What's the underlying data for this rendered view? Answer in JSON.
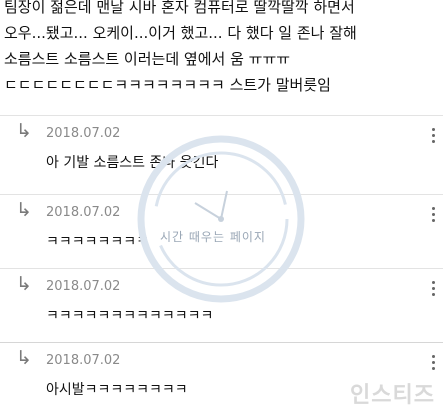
{
  "post": {
    "lines": [
      "팀장이 젊은데 맨날 시바 혼자 컴퓨터로 딸깍딸깍 하면서",
      "오우...됐고... 오케이...이거 했고... 다 했다 일 존나 잘해",
      "소름스트 소름스트 이러는데 옆에서 움 ㅠㅠㅠ",
      "ㄷㄷㄷㄷㄷㄷㄷㄷㅋㅋㅋㅋㅋㅋㅋㅋ 스트가 말버릇임"
    ]
  },
  "replies": [
    {
      "arrow": "↳",
      "date": "2018.07.02",
      "text": "아 기발 소름스트 존나 웃긴다"
    },
    {
      "arrow": "↳",
      "date": "2018.07.02",
      "text": "ㅋㅋㅋㅋㅋㅋㅋㅋ"
    },
    {
      "arrow": "↳",
      "date": "2018.07.02",
      "text": "ㅋㅋㅋㅋㅋㅋㅋㅋㅋㅋㅋㅋㅋ"
    },
    {
      "arrow": "↳",
      "date": "2018.07.02",
      "text": "아시발ㅋㅋㅋㅋㅋㅋㅋㅋ"
    }
  ],
  "watermark": {
    "label": "시간 때우는 페이지",
    "site": "인스티즈"
  },
  "icons": {
    "reply": "reply-arrow-icon",
    "more": "more-vertical-icon",
    "watermark": "clock-stamp-icon"
  },
  "colors": {
    "divider": "#e3e3e3",
    "date": "#8a8a8a",
    "watermark": "#9aa7b6"
  }
}
